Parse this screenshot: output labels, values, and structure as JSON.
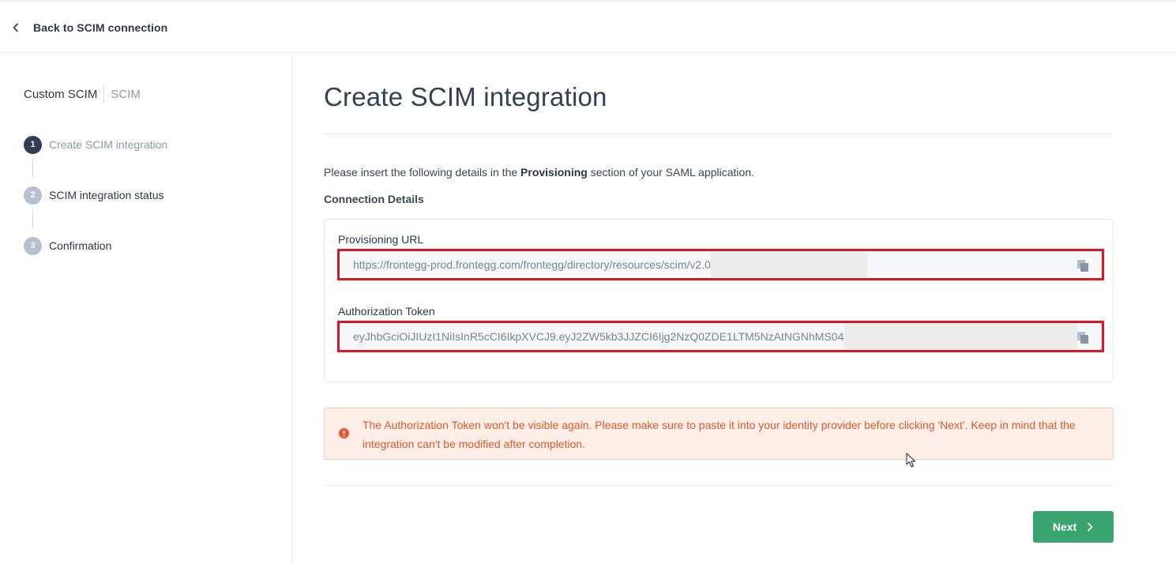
{
  "nav": {
    "back_label": "Back to SCIM connection"
  },
  "sidebar": {
    "provider_name": "Custom SCIM",
    "provider_type": "SCIM",
    "steps": [
      {
        "number": "1",
        "label": "Create SCIM integration",
        "state": "active"
      },
      {
        "number": "2",
        "label": "SCIM integration status",
        "state": "pending"
      },
      {
        "number": "3",
        "label": "Confirmation",
        "state": "pending"
      }
    ]
  },
  "main": {
    "title": "Create SCIM integration",
    "instruction_prefix": "Please insert the following details in the ",
    "instruction_bold": "Provisioning",
    "instruction_suffix": " section of your SAML application.",
    "connection_heading": "Connection Details",
    "fields": [
      {
        "label": "Provisioning URL",
        "value": "https://frontegg-prod.frontegg.com/frontegg/directory/resources/scim/v2.0"
      },
      {
        "label": "Authorization Token",
        "value": "eyJhbGciOiJIUzI1NiIsInR5cCI6IkpXVCJ9.eyJ2ZW5kb3JJZCI6Ijg2NzQ0ZDE1LTM5NzAtNGNhMS04"
      }
    ],
    "warning": "The Authorization Token won't be visible again. Please make sure to paste it into your identity provider before clicking 'Next'. Keep in mind that the integration can't be modified after completion.",
    "next_label": "Next"
  },
  "icons": {
    "back": "chevron-left-icon",
    "copy": "copy-icon",
    "warning": "exclamation-circle-icon",
    "next": "chevron-right-icon"
  },
  "colors": {
    "primary_button": "#3aa471",
    "warning_text": "#e0582b",
    "warning_bg": "#fdeee8",
    "highlight_border": "#e3131d",
    "active_step": "#2f3e54",
    "inactive_step": "#b4c0cf"
  }
}
